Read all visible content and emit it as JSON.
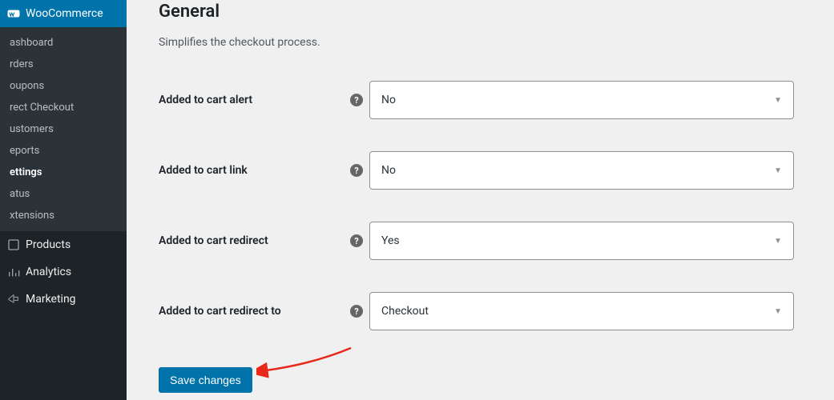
{
  "sidebar": {
    "main": [
      {
        "label": "WooCommerce",
        "active": true
      },
      {
        "label": "Products"
      },
      {
        "label": "Analytics"
      },
      {
        "label": "Marketing"
      }
    ],
    "sub": [
      {
        "label": "ashboard"
      },
      {
        "label": "rders"
      },
      {
        "label": "oupons"
      },
      {
        "label": "rect Checkout"
      },
      {
        "label": "ustomers"
      },
      {
        "label": "eports"
      },
      {
        "label": "ettings",
        "active": true
      },
      {
        "label": "atus"
      },
      {
        "label": "xtensions"
      }
    ]
  },
  "section": {
    "title": "General",
    "description": "Simplifies the checkout process."
  },
  "fields": {
    "added_to_cart_alert": {
      "label": "Added to cart alert",
      "value": "No"
    },
    "added_to_cart_link": {
      "label": "Added to cart link",
      "value": "No"
    },
    "added_to_cart_redirect": {
      "label": "Added to cart redirect",
      "value": "Yes"
    },
    "added_to_cart_redirect_to": {
      "label": "Added to cart redirect to",
      "value": "Checkout"
    }
  },
  "actions": {
    "save": "Save changes"
  }
}
